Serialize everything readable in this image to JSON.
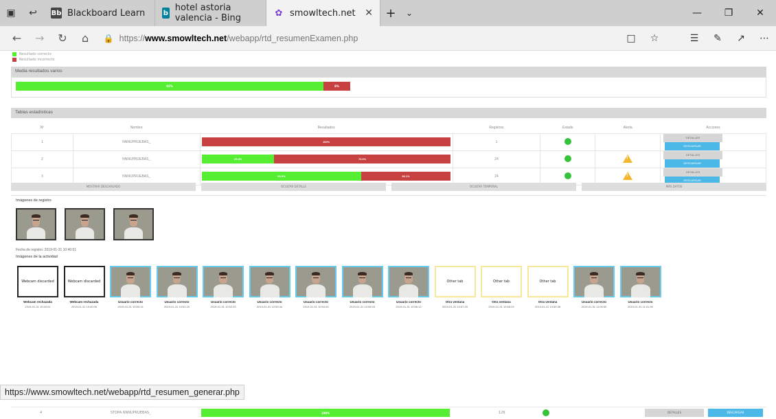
{
  "browser": {
    "tabs": [
      {
        "title": "Blackboard Learn",
        "active": false,
        "icon": "blackboard-icon"
      },
      {
        "title": "hotel astoria valencia - Bing",
        "active": false,
        "icon": "bing-icon"
      },
      {
        "title": "smowltech.net",
        "active": true,
        "icon": "smowl-icon"
      }
    ],
    "url_prefix": "https://",
    "url_host": "www.smowltech.net",
    "url_path": "/webapp/rtd_resumenExamen.php",
    "status_url": "https://www.smowltech.net/webapp/rtd_resumen_generar.php"
  },
  "page": {
    "legend": [
      {
        "label": "Resultado correcto",
        "color": "#55ee33"
      },
      {
        "label": "Resultado incorrecto",
        "color": "#c84141"
      }
    ],
    "summary_title": "Media resultados varios",
    "summary_bar": {
      "green_pct": 92,
      "red_pct": 8,
      "green_label": "92%",
      "red_label": "8%"
    },
    "stats_title": "Tablas estadísticas",
    "columns": [
      "Nº",
      "Nombre",
      "Resultados",
      "Registros",
      "Estado",
      "Alerta",
      "Acciones"
    ],
    "rows": [
      {
        "n": "1",
        "name": "NNNUPRUEBAS_",
        "green_pct": 0,
        "red_pct": 100,
        "green_label": "",
        "red_label": "100%",
        "registros": "1",
        "alert": false
      },
      {
        "n": "2",
        "name": "NNNUPRUEBAS_",
        "green_pct": 29,
        "red_pct": 71,
        "green_label": "29.4%",
        "red_label": "70.6%",
        "registros": "24",
        "alert": true
      },
      {
        "n": "3",
        "name": "NNNUPRUEBAS_",
        "green_pct": 64,
        "red_pct": 36,
        "green_label": "63.9%",
        "red_label": "36.1%",
        "registros": "24",
        "alert": true
      }
    ],
    "row4": {
      "n": "4",
      "name": "STOPA NNNUPRUEBAS_",
      "green_label": "100%",
      "registros": "126"
    },
    "btn_details": "DETALLES",
    "btn_download": "DESCARGAR",
    "section_tabs": [
      "MOSTRAR DESCARGADO",
      "OCULTAR DETALLE",
      "OCULTAR TEMPORAL",
      "MÁS DATOS"
    ],
    "registro_title": "Imágenes de registro",
    "registro_date": "Fecha de registro: 2019-01-31 10:40:01",
    "actividad_title": "Imágenes de la actividad",
    "activity": [
      {
        "type": "disc",
        "text": "Webcam discarded",
        "label": "Webcam rechazada",
        "time": "2019-01-31 10:40:01"
      },
      {
        "type": "disc",
        "text": "Webcam discarded",
        "label": "Webcam rechazada",
        "time": "2019-01-31 10:40:05"
      },
      {
        "type": "user",
        "text": "",
        "label": "Usuario correcto",
        "time": "2019-01-31 10:50:14"
      },
      {
        "type": "user",
        "text": "",
        "label": "Usuario correcto",
        "time": "2019-01-31 10:51:20"
      },
      {
        "type": "user",
        "text": "",
        "label": "Usuario correcto",
        "time": "2019-01-31 10:52:33"
      },
      {
        "type": "user",
        "text": "",
        "label": "Usuario correcto",
        "time": "2019-01-31 10:53:44"
      },
      {
        "type": "user",
        "text": "",
        "label": "Usuario correcto",
        "time": "2019-01-31 10:54:53"
      },
      {
        "type": "user",
        "text": "",
        "label": "Usuario correcto",
        "time": "2019-01-31 10:55:03"
      },
      {
        "type": "user",
        "text": "",
        "label": "Usuario correcto",
        "time": "2019-01-31 10:56:12"
      },
      {
        "type": "other",
        "text": "Other tab",
        "label": "Otra ventana",
        "time": "2019-01-31 10:57:20"
      },
      {
        "type": "other",
        "text": "Other tab",
        "label": "Otra ventana",
        "time": "2019-01-31 10:58:29"
      },
      {
        "type": "other",
        "text": "Other tab",
        "label": "Otra ventana",
        "time": "2019-01-31 10:59:38"
      },
      {
        "type": "user",
        "text": "",
        "label": "Usuario correcto",
        "time": "2019-01-31 11:00:50"
      },
      {
        "type": "user",
        "text": "",
        "label": "Usuario correcto",
        "time": "2019-01-31 11:01:59"
      }
    ],
    "colors": {
      "green": "#55ee33",
      "red": "#c84141",
      "status_green": "#36c23a",
      "warning": "#f4b52b",
      "details_btn": "#d6d6d6",
      "download_btn": "#4cb8e8"
    }
  }
}
